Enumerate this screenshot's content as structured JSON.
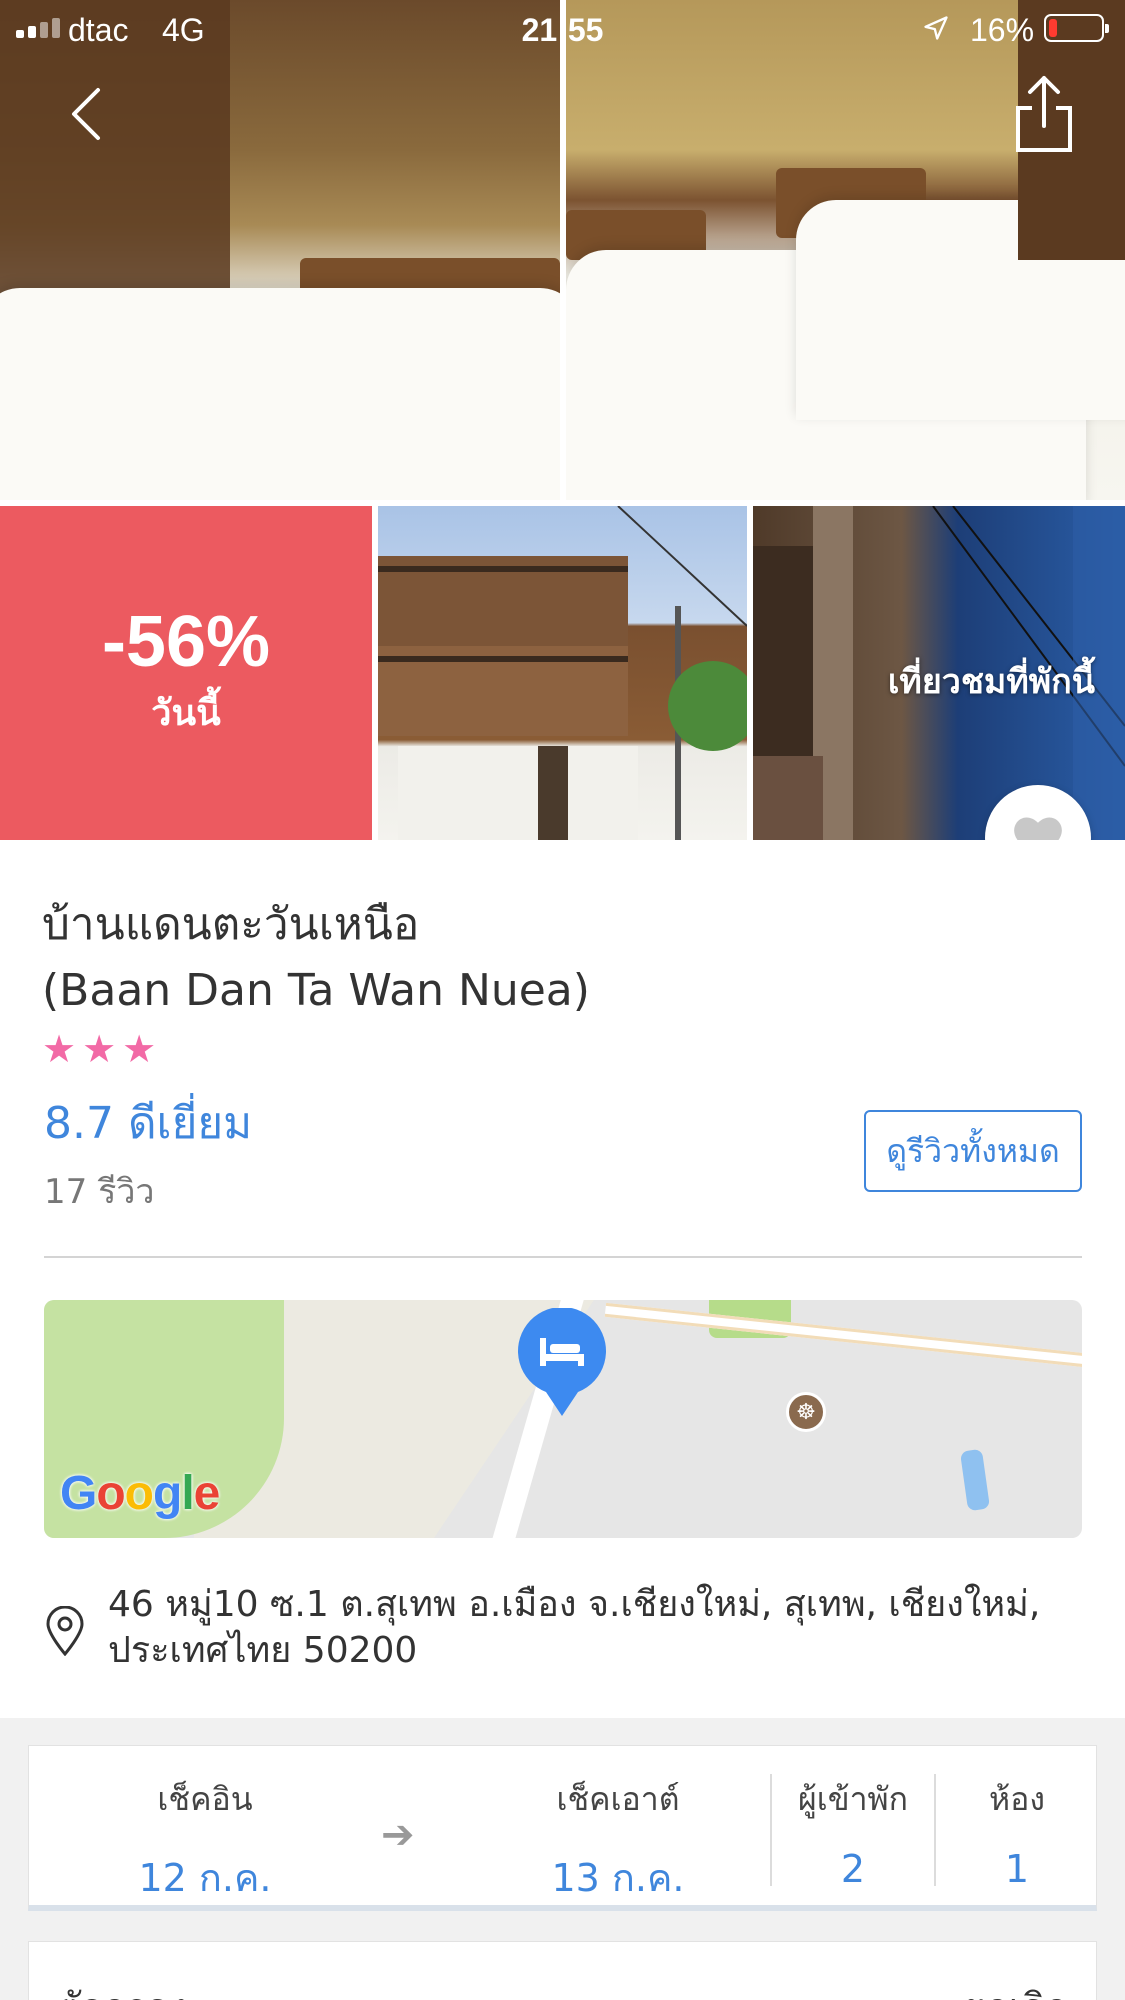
{
  "status_bar": {
    "carrier": "dtac",
    "network": "4G",
    "time": "21:55",
    "battery": "16%",
    "battery_level": 0.16
  },
  "gallery": {
    "promo_percent": "-56%",
    "promo_sub": "วันนี้",
    "tour_label": "เที่ยวชมที่พักนี้"
  },
  "hotel": {
    "name_thai": "บ้านแดนตะวันเหนือ",
    "name_english": "(Baan Dan Ta Wan Nuea)",
    "stars": 3,
    "rating": "8.7 ดีเยี่ยม",
    "review_count": "17 รีวิว",
    "reviews_button": "ดูรีวิวทั้งหมด",
    "address_line1": "46 หมู่10 ซ.1 ต.สุเทพ อ.เมือง จ.เชียงใหม่, สุเทพ, เชียงใหม่,",
    "address_line2": "ประเทศไทย 50200"
  },
  "map": {
    "provider_logo": "Google"
  },
  "search": {
    "checkin_label": "เช็คอิน",
    "checkin_value": "12 ก.ค.",
    "checkout_label": "เช็คเอาต์",
    "checkout_value": "13 ก.ค.",
    "guests_label": "ผู้เข้าพัก",
    "guests_value": "2",
    "rooms_label": "ห้อง",
    "rooms_value": "1"
  },
  "filter": {
    "title": "ตัวกรอง",
    "clear": "ยกเลิก"
  },
  "colors": {
    "promo": "#ec5a60",
    "accent": "#3f86dc",
    "star": "#f26aa6"
  }
}
